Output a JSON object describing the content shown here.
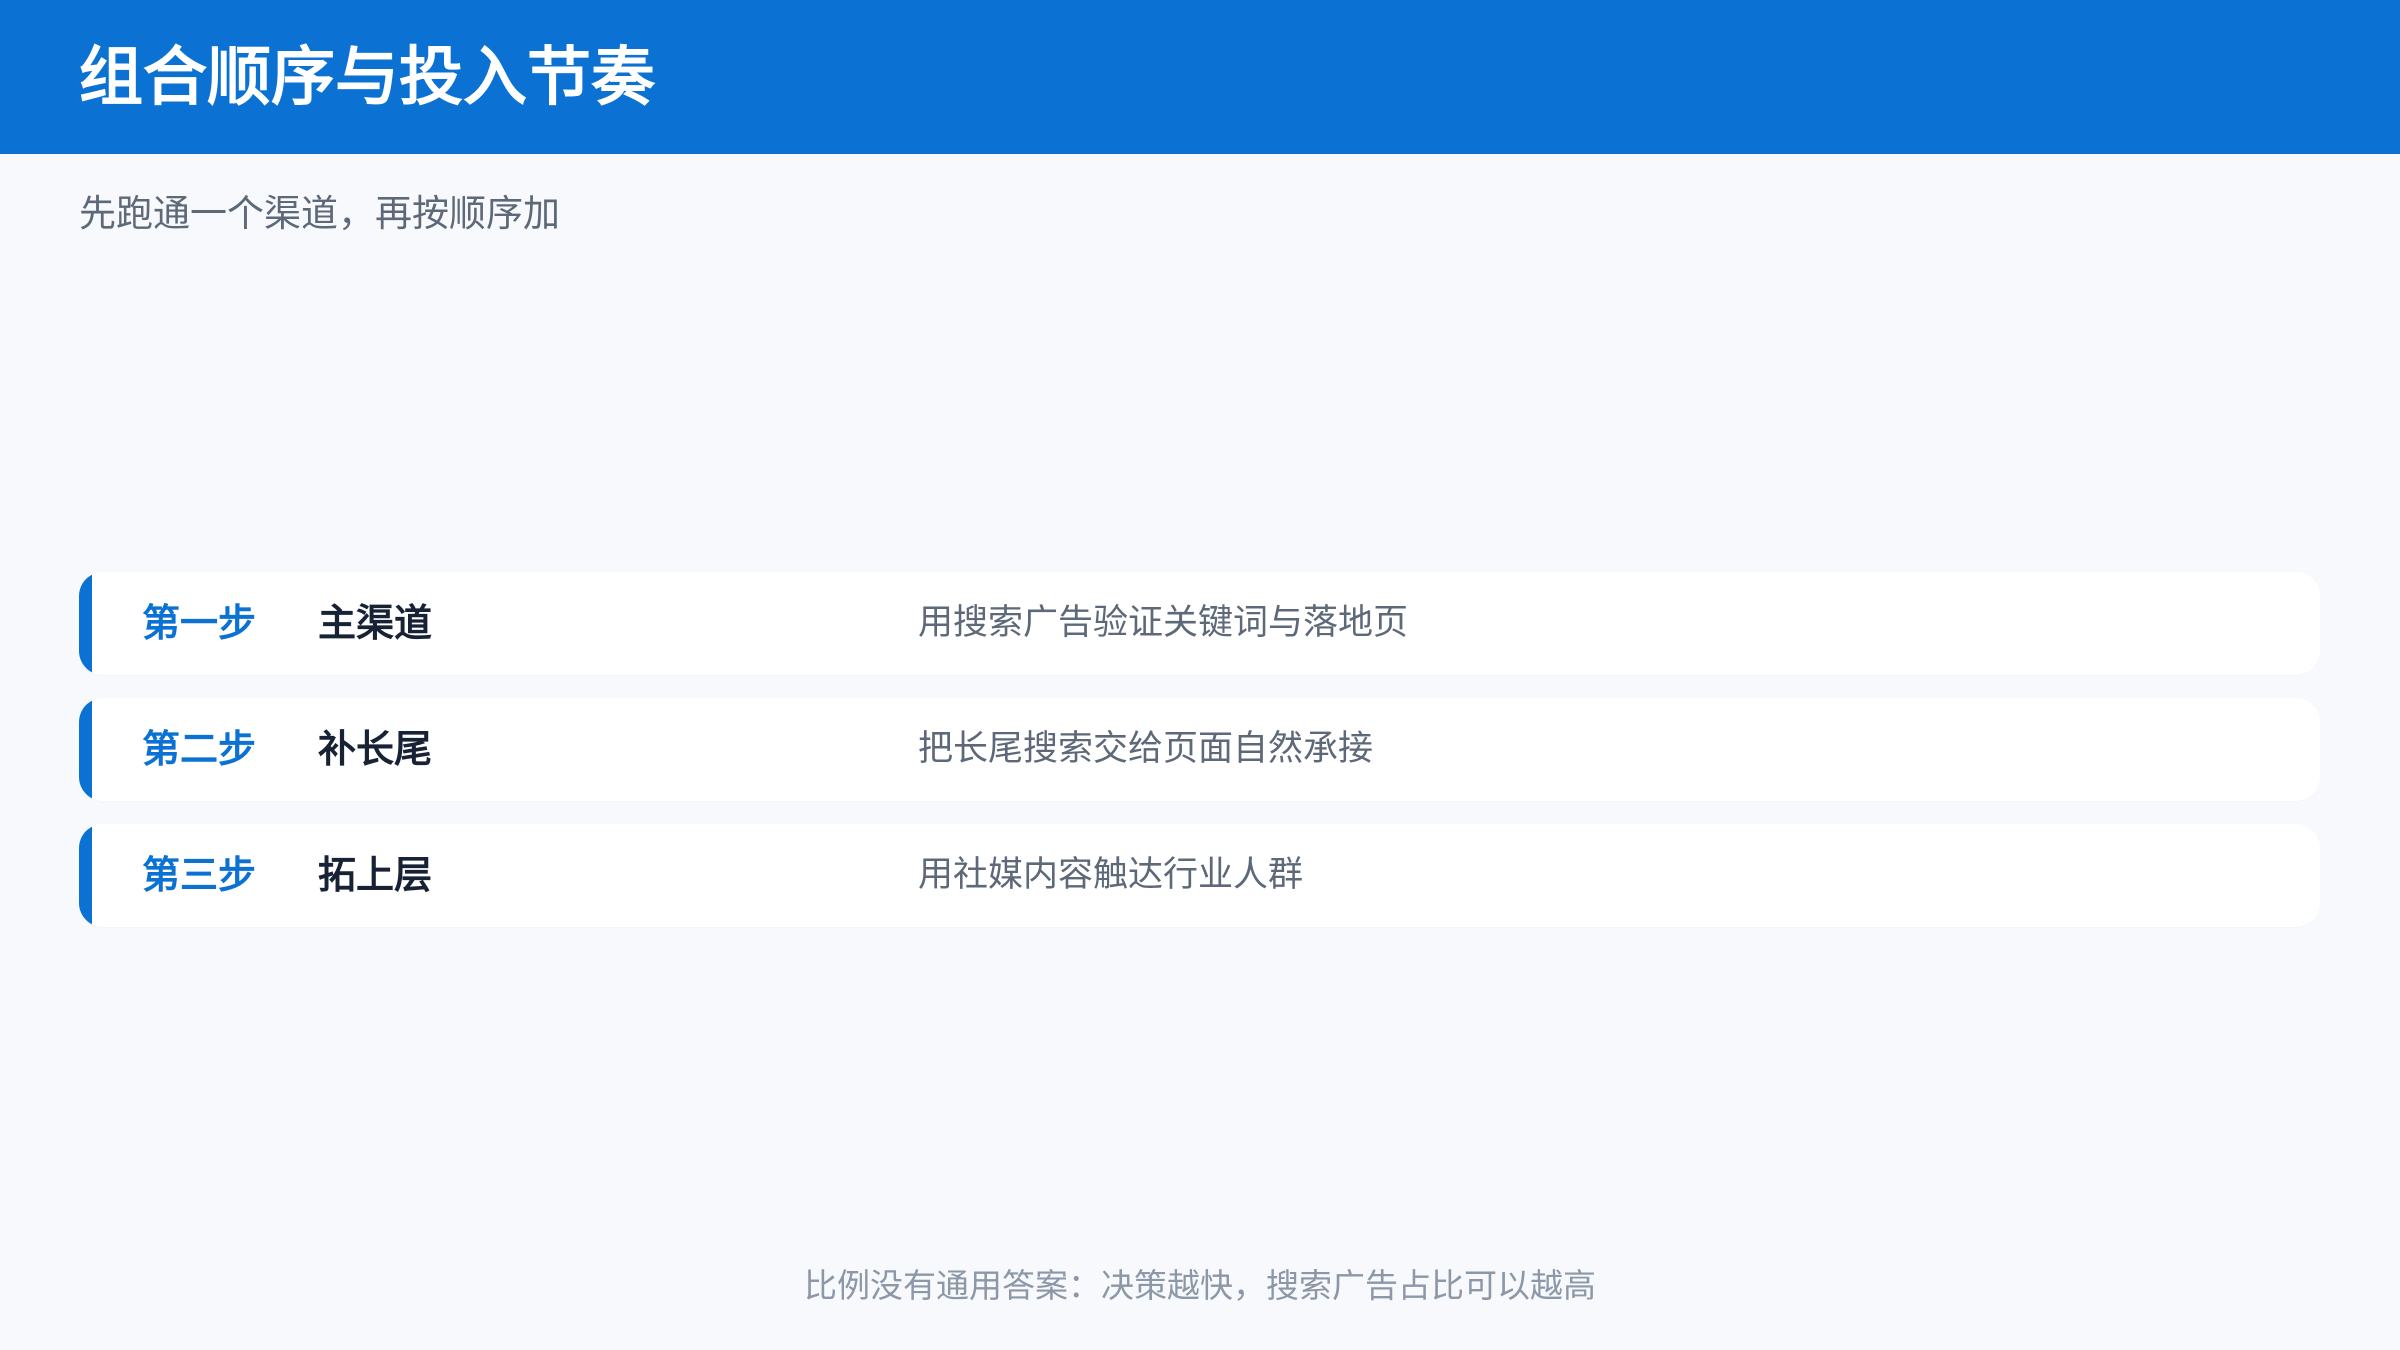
{
  "header": {
    "title": "组合顺序与投入节奏"
  },
  "subtitle": "先跑通一个渠道，再按顺序加",
  "steps": [
    {
      "label": "第一步",
      "channel": "主渠道",
      "description": "用搜索广告验证关键词与落地页"
    },
    {
      "label": "第二步",
      "channel": "补长尾",
      "description": "把长尾搜索交给页面自然承接"
    },
    {
      "label": "第三步",
      "channel": "拓上层",
      "description": "用社媒内容触达行业人群"
    }
  ],
  "footer": {
    "note": "比例没有通用答案：决策越快，搜索广告占比可以越高"
  },
  "colors": {
    "accent": "#0b72d4",
    "background": "#f7f9fc",
    "card": "#ffffff",
    "heading_text": "#172235",
    "body_text": "#5d6878",
    "muted_text": "#8c97a7"
  }
}
